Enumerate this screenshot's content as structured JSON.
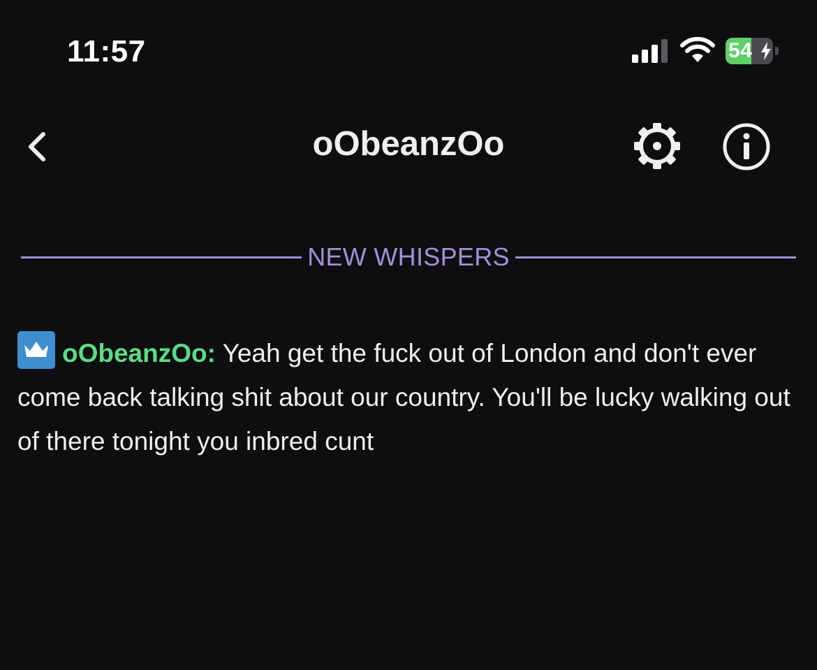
{
  "status_bar": {
    "time": "11:57",
    "battery_label": "54",
    "battery_level": 0.54,
    "signal_icon": "cellular-signal-icon",
    "wifi_icon": "wifi-icon",
    "charging_icon": "bolt-icon"
  },
  "header": {
    "back_icon": "chevron-left-icon",
    "title": "oObeanzOo",
    "settings_icon": "gear-icon",
    "info_icon": "info-icon"
  },
  "divider": {
    "label": "NEW WHISPERS"
  },
  "messages": [
    {
      "badge_icon": "crown-icon",
      "username": "oObeanzOo",
      "separator": ":",
      "text": " Yeah get the fuck out of London and don't ever come back talking shit about our country. You'll be lucky walking out of there tonight you inbred cunt"
    }
  ],
  "colors": {
    "background": "#0e0e10",
    "text": "#efeff1",
    "accent": "#a390d8",
    "username": "#5bdc84",
    "badge": "#3e8ed0",
    "battery": "#5fd067"
  }
}
